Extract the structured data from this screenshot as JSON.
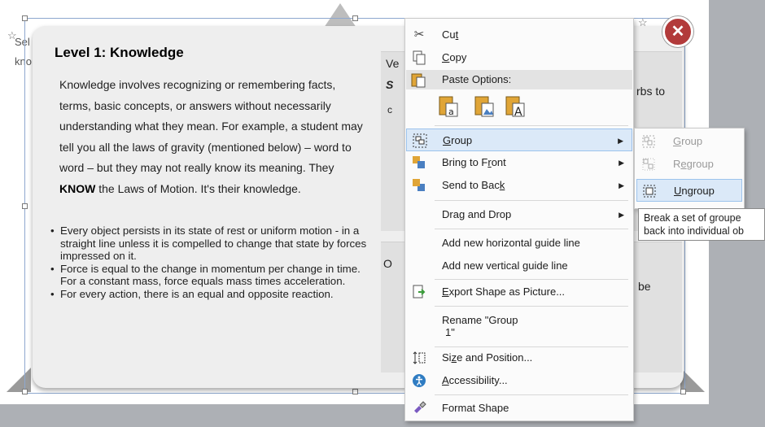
{
  "card": {
    "title": "Level 1: Knowledge",
    "paragraph_parts": [
      "Knowledge involves recognizing or remembering facts, terms, basic concepts, or answers without necessarily understanding what they mean. For example, a student may tell you all the laws of gravity (mentioned below) – word to word – but they may not really know its meaning. They ",
      "KNOW",
      " the Laws of Motion. It's their knowledge."
    ],
    "bullets": [
      "Every object persists in its state of rest or uniform motion -  in a straight line unless it is compelled to change that state by forces impressed on it.",
      "Force is equal to the change in momentum per change in time. For a constant mass, force equals mass times acceleration.",
      "For every action, there is an equal and opposite reaction."
    ]
  },
  "behind_text": [
    "Sel",
    "kno"
  ],
  "right_fragments": {
    "top_ve": "Ve",
    "top_s": "S",
    "top_c": "c",
    "top_rbs": "rbs to",
    "bottom_o": "O",
    "bottom_be": "be"
  },
  "context_menu": {
    "cut": "Cut",
    "copy": "Copy",
    "paste_options": "Paste Options:",
    "group": "Group",
    "bring_to_front": "Bring to Front",
    "send_to_back": "Send to Back",
    "drag_and_drop": "Drag and Drop",
    "add_horizontal_guide": "Add new horizontal guide line",
    "add_vertical_guide": "Add new vertical guide line",
    "export_shape": "Export Shape as Picture...",
    "rename_line1": "Rename \"Group",
    "rename_line2": "1\"",
    "size_and_position": "Size and Position...",
    "accessibility": "Accessibility...",
    "format_shape": "Format Shape"
  },
  "submenu": {
    "group": "Group",
    "regroup": "Regroup",
    "ungroup": "Ungroup"
  },
  "tooltip": {
    "line1": "Break a set of groupe",
    "line2": "back into individual ob"
  },
  "colors": {
    "close_button": "#b23a3a",
    "menu_highlight": "#dbe9f8",
    "menu_highlight_border": "#9cc3ec"
  }
}
